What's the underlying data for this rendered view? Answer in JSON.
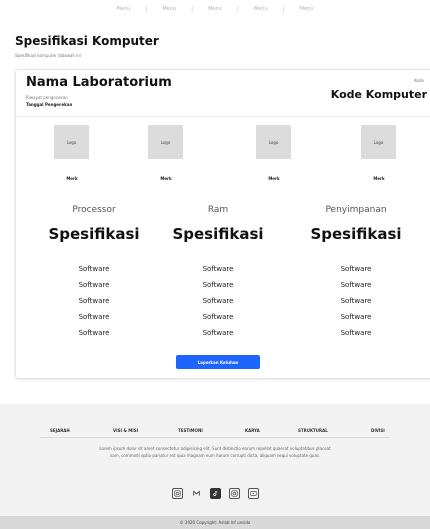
{
  "nav": {
    "items": [
      "Menu",
      "Menu",
      "Menu",
      "Menu",
      "Menu"
    ]
  },
  "page": {
    "title": "Spesifikasi Komputer",
    "subtitle": "Spesifikasi komputer dibawah ini"
  },
  "lab": {
    "title": "Nama Laboratorium",
    "line1": "Riwayat pengecekan",
    "line2": "Tanggal Pengecekan",
    "kode_label": "Kode",
    "kode_value": "Kode Komputer"
  },
  "logos": [
    {
      "label": "Logo",
      "merk": "Merk"
    },
    {
      "label": "Logo",
      "merk": "Merk"
    },
    {
      "label": "Logo",
      "merk": "Merk"
    },
    {
      "label": "Logo",
      "merk": "Merk"
    }
  ],
  "columns": [
    {
      "heading": "Processor",
      "spec": "Spesifikasi",
      "software": [
        "Software",
        "Software",
        "Software",
        "Software",
        "Software"
      ]
    },
    {
      "heading": "Ram",
      "spec": "Spesifikasi",
      "software": [
        "Software",
        "Software",
        "Software",
        "Software",
        "Software"
      ]
    },
    {
      "heading": "Penyimpanan",
      "spec": "Spesifikasi",
      "software": [
        "Software",
        "Software",
        "Software",
        "Software",
        "Software"
      ]
    }
  ],
  "button": {
    "label": "Laporkan Keluhan"
  },
  "footer": {
    "links": [
      "SEJARAH",
      "VISI & MISI",
      "TESTIMONI",
      "KARYA",
      "STRUKTURAL",
      "DIVISI"
    ],
    "text": "Lorem ipsum dolor sit amet consectetur adipisicing elit. Sunt distinctio earum repellat quaerat voluptatibus placeat nam, commodi optio pariatur est quia magnam eum harum corrupti dicta, aliquam sequi voluptate quas.",
    "social": [
      "instagram-icon",
      "gmail-icon",
      "tiktok-icon",
      "instagram-icon",
      "youtube-icon"
    ],
    "copyright": "© 2020 Copyright: Aslab Inf unsida"
  },
  "colors": {
    "accent": "#1e64ff",
    "footer_bg": "#f3f3f3",
    "copyright_bg": "#d9d9d9"
  }
}
